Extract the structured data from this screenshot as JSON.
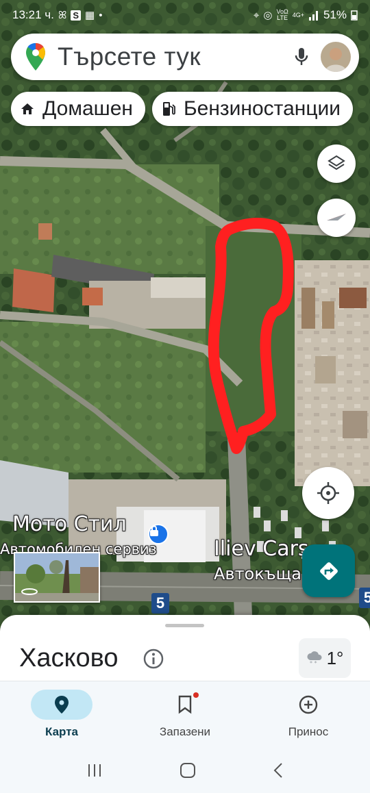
{
  "status_bar": {
    "time": "13:21 ч.",
    "network_top": "VoΩ",
    "network_bottom": "LTE",
    "signal_label": "4G+",
    "battery": "51%"
  },
  "search": {
    "placeholder": "Търсете тук"
  },
  "chips": [
    {
      "label": "Домашен",
      "icon": "home-icon"
    },
    {
      "label": "Бензиностанции",
      "icon": "gas-station-icon"
    }
  ],
  "map": {
    "labels": {
      "moto": "Мото Стил",
      "moto_sub": "Автомобилен сервиз",
      "iliev": "Iliev Cars",
      "iliev_sub": "Автокъща"
    },
    "road_number": "5",
    "annotation_color": "#ff2020"
  },
  "place": {
    "title": "Хасково",
    "temperature": "1°",
    "weather_icon": "snow-cloud-icon"
  },
  "bottom_nav": [
    {
      "label": "Карта",
      "icon": "map-pin-icon",
      "active": true
    },
    {
      "label": "Запазени",
      "icon": "bookmark-icon",
      "active": false
    },
    {
      "label": "Принос",
      "icon": "add-circle-icon",
      "active": false
    }
  ],
  "colors": {
    "accent_teal": "#00737a",
    "nav_active_bg": "#c2e7f5"
  }
}
